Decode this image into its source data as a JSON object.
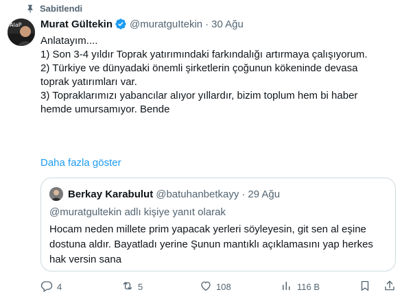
{
  "pinned": {
    "label": "Sabitlendi",
    "icon": "pin-icon"
  },
  "tweet": {
    "avatar_text": "AlaP",
    "author_name": "Murat Gültekin",
    "author_handle": "@muratguItekin",
    "separator": "·",
    "date": "30 Ağu",
    "verified_color": "#1d9bf0",
    "text_lines": [
      "Anlatayım....",
      "",
      "1) Son 3-4 yıldır Toprak yatırımındaki farkındalığı artırmaya çalışıyorum.",
      "",
      "2) Türkiye ve dünyadaki önemli şirketlerin çoğunun kökeninde devasa\ntoprak yatırımları var.",
      "",
      "3) Topraklarımızı yabancılar alıyor yıllardır, bizim toplum hem bi haber\nhemde umursamıyor. Bende"
    ],
    "show_more": "Daha fazla göster"
  },
  "quote": {
    "author_name": "Berkay Karabulut",
    "author_handle": "@batuhanbetkayy",
    "separator": "·",
    "date": "29 Ağu",
    "reply_context": "@muratgultekin adlı kişiye yanıt olarak",
    "text": "Hocam neden millete prim yapacak yerleri söyleyesin, git sen al eşine dostuna aldır. Bayatladı yerine Şunun mantıklı açıklamasını yap herkes hak versin sana"
  },
  "actions": {
    "replies": "4",
    "reposts": "5",
    "likes": "108",
    "views": "116 B"
  },
  "colors": {
    "accent": "#1d9bf0",
    "secondary_text": "#536471",
    "border": "#cfd9de"
  }
}
